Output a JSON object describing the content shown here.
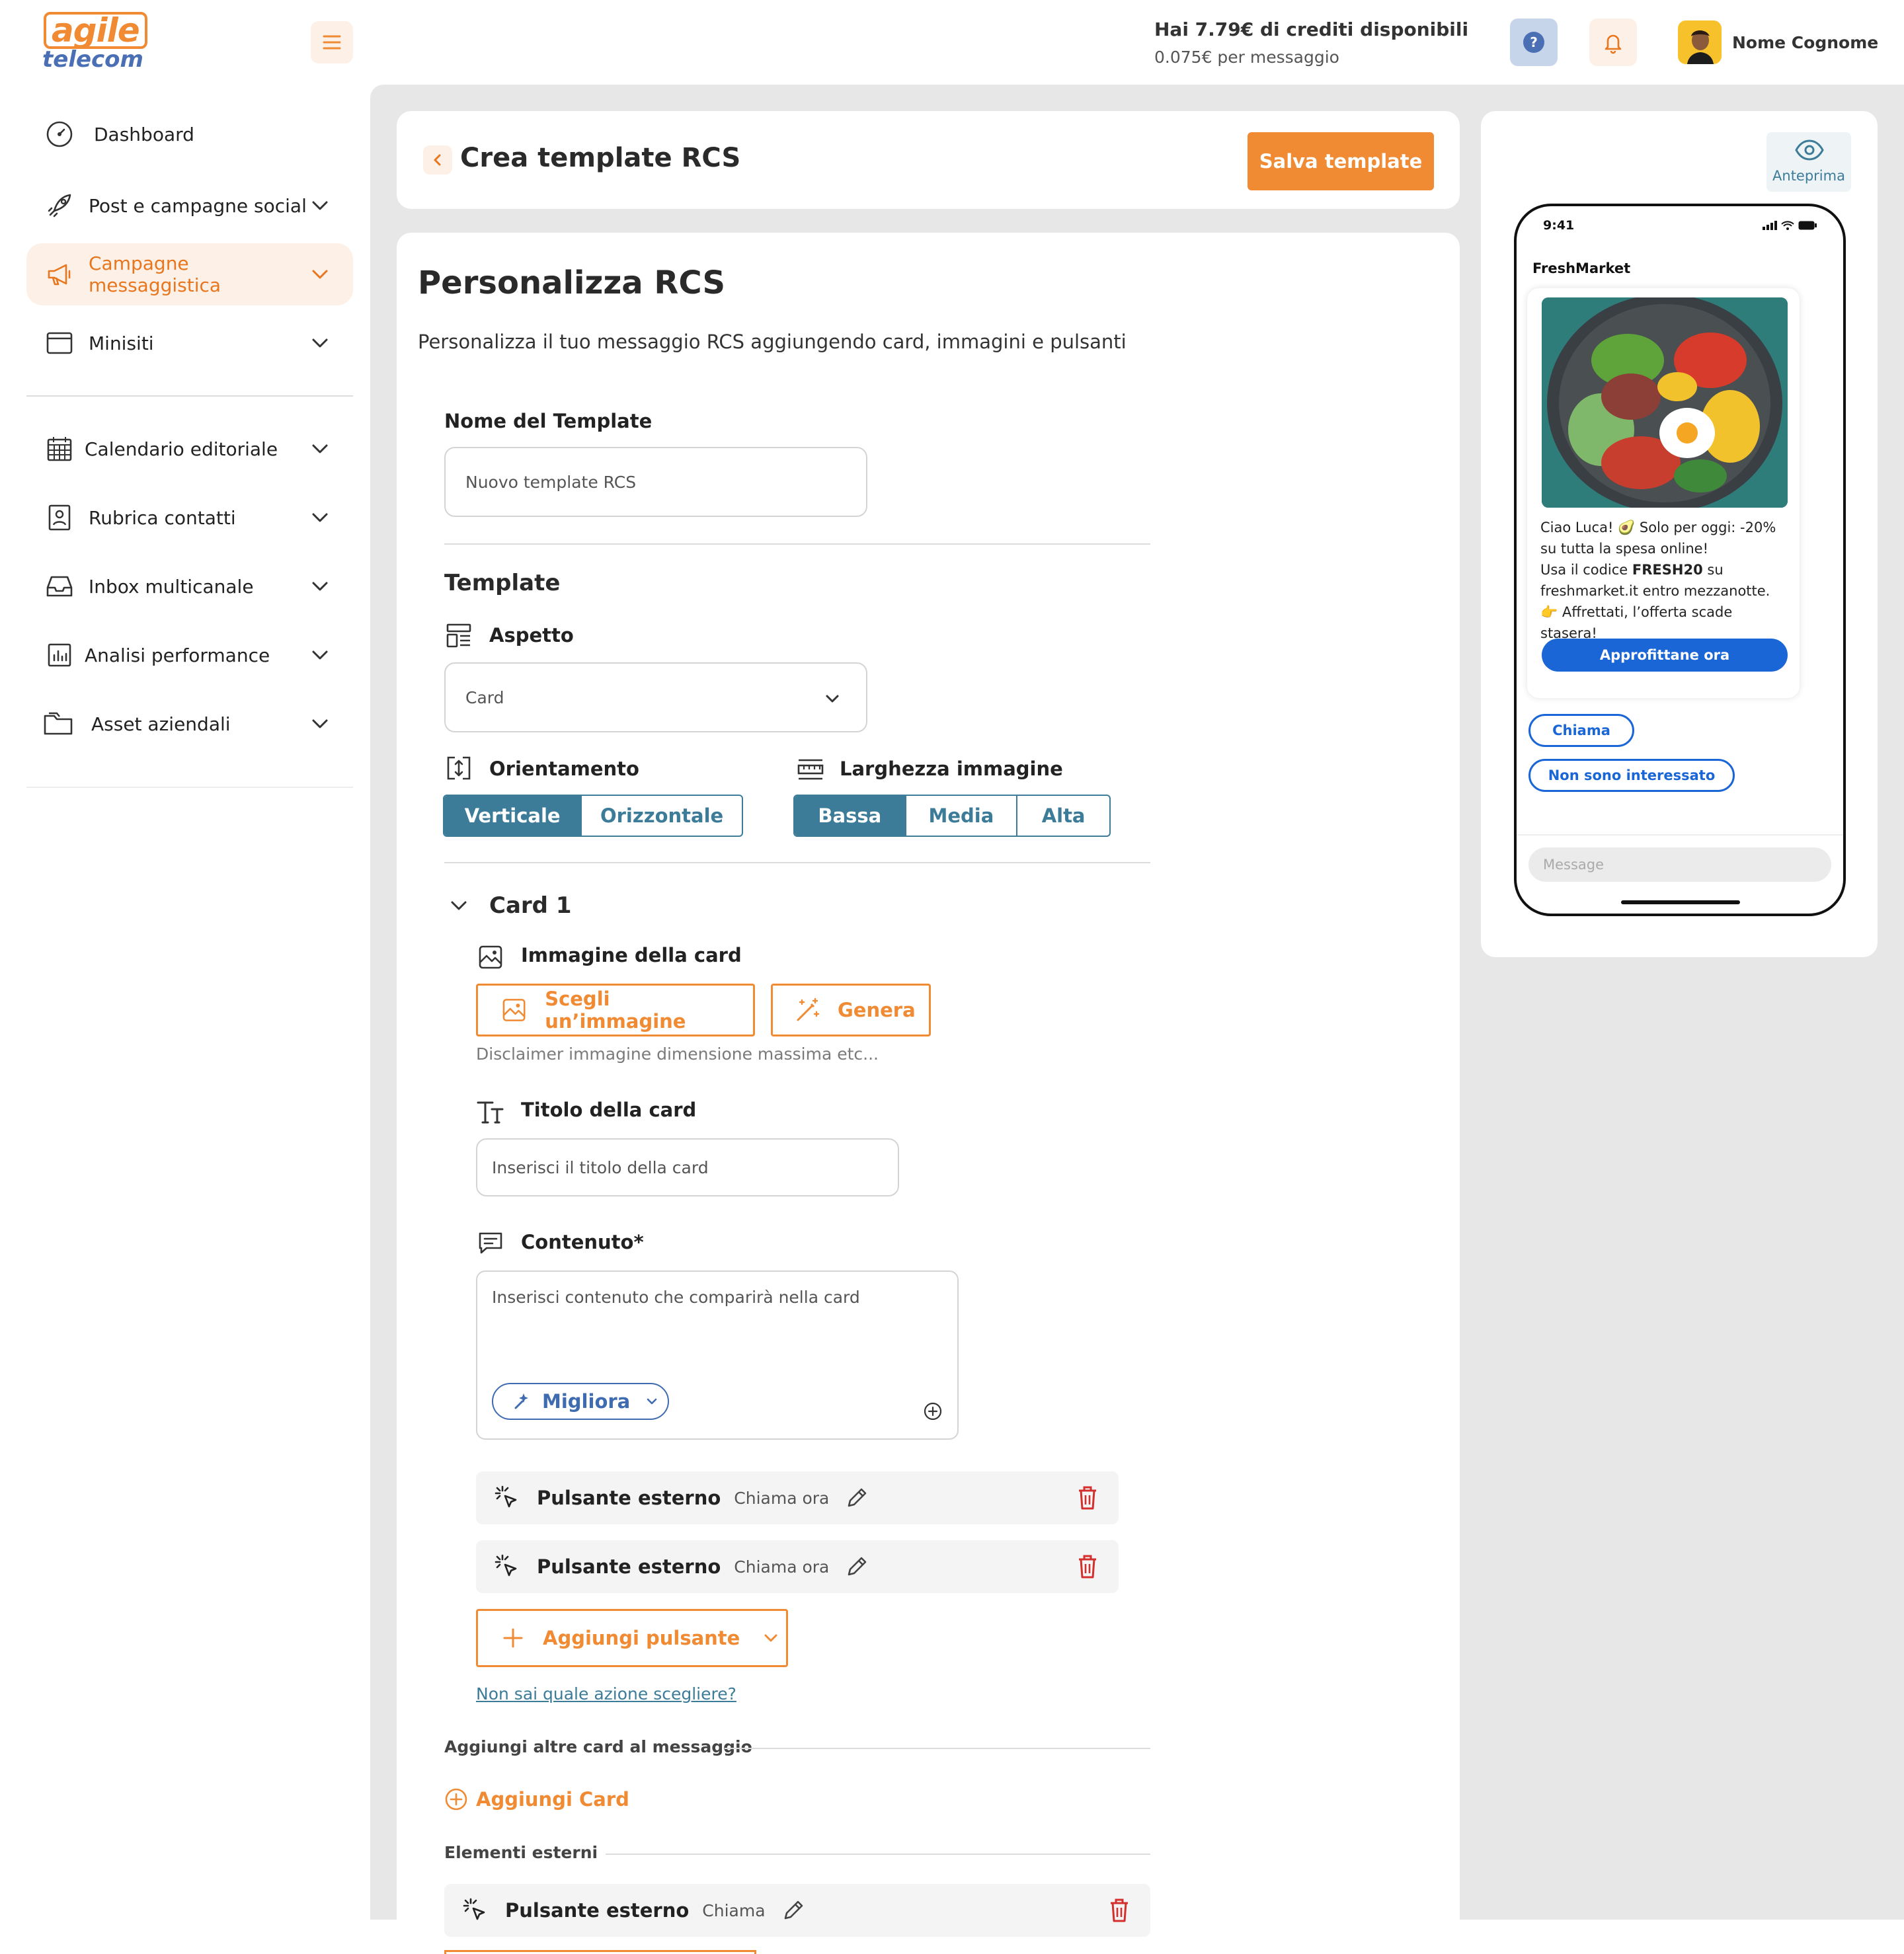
{
  "brand": {
    "logo_top": "agile",
    "logo_bottom": "telecom"
  },
  "header": {
    "credits": "Hai 7.79€ di crediti disponibili",
    "price": "0.075€ per messaggio",
    "user_name": "Nome Cognome"
  },
  "sidebar": {
    "items": [
      {
        "label": "Dashboard",
        "icon": "dashboard-icon"
      },
      {
        "label": "Post e campagne social",
        "icon": "rocket-icon"
      },
      {
        "label": "Campagne messaggistica",
        "icon": "megaphone-icon",
        "active": true
      },
      {
        "label": "Minisiti",
        "icon": "browser-icon"
      },
      {
        "label": "Calendario editoriale",
        "icon": "calendar-icon"
      },
      {
        "label": "Rubrica contatti",
        "icon": "contact-icon"
      },
      {
        "label": "Inbox multicanale",
        "icon": "inbox-icon"
      },
      {
        "label": "Analisi performance",
        "icon": "chart-icon"
      },
      {
        "label": "Asset aziendali",
        "icon": "folder-icon"
      }
    ]
  },
  "page": {
    "title": "Crea template RCS",
    "save_button": "Salva template",
    "section_title": "Personalizza RCS",
    "section_desc": "Personalizza il tuo messaggio RCS aggiungendo card, immagini e pulsanti"
  },
  "form": {
    "template_name_label": "Nome del Template",
    "template_name_placeholder": "Nuovo template RCS",
    "template_heading": "Template",
    "aspect_label": "Aspetto",
    "aspect_value": "Card",
    "orientation_label": "Orientamento",
    "orientation_options": [
      "Verticale",
      "Orizzontale"
    ],
    "orientation_selected": "Verticale",
    "width_label": "Larghezza immagine",
    "width_options": [
      "Bassa",
      "Media",
      "Alta"
    ],
    "width_selected": "Bassa",
    "card_title": "Card 1",
    "card_image_label": "Immagine della card",
    "choose_image": "Scegli un’immagine",
    "generate": "Genera",
    "image_disclaimer": "Disclaimer immagine dimensione massima etc...",
    "card_title_label": "Titolo della card",
    "card_title_placeholder": "Inserisci il titolo della card",
    "content_label": "Contenuto*",
    "content_placeholder": "Inserisci contenuto che comparirà nella card",
    "improve": "Migliora",
    "buttons": [
      {
        "type": "Pulsante esterno",
        "action": "Chiama ora"
      },
      {
        "type": "Pulsante esterno",
        "action": "Chiama ora"
      }
    ],
    "add_button": "Aggiungi pulsante",
    "help_link": "Non sai quale azione scegliere?",
    "add_more_cards_label": "Aggiungi altre card al messaggio",
    "add_card": "Aggiungi Card",
    "external_elements_label": "Elementi esterni",
    "external_buttons": [
      {
        "type": "Pulsante esterno",
        "action": "Chiama"
      }
    ]
  },
  "preview": {
    "label": "Anteprima",
    "time": "9:41",
    "sender": "FreshMarket",
    "message_lines": [
      "Ciao Luca! 🥑 Solo per oggi: -20%",
      "su tutta la spesa online!"
    ],
    "line3_pre": "Usa il codice ",
    "code": "FRESH20",
    "line3_post": " su",
    "line4": "freshmarket.it entro mezzanotte.",
    "line5": "👉 Affrettati, l’offerta scade stasera!",
    "cta": "Approfittane ora",
    "chips": [
      "Chiama",
      "Non sono interessato"
    ],
    "input_placeholder": "Message"
  },
  "colors": {
    "accent": "#f08a33",
    "teal": "#3c7c99",
    "rcs_blue": "#1a66d6",
    "danger": "#d32f2f"
  }
}
